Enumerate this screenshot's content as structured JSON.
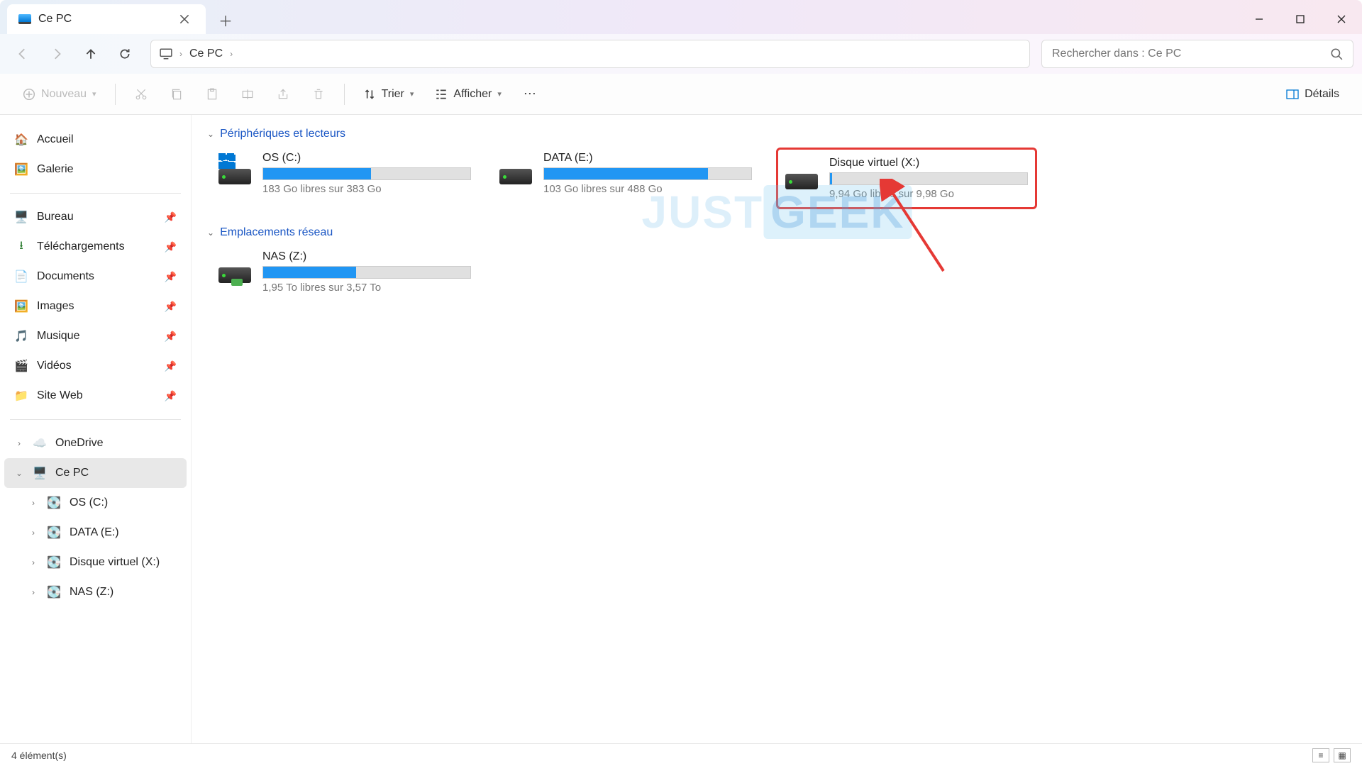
{
  "tab": {
    "title": "Ce PC"
  },
  "breadcrumb": {
    "root": "Ce PC"
  },
  "search": {
    "placeholder": "Rechercher dans : Ce PC"
  },
  "toolbar": {
    "new": "Nouveau",
    "sort": "Trier",
    "view": "Afficher",
    "details": "Détails"
  },
  "sidebar": {
    "home": "Accueil",
    "gallery": "Galerie",
    "pinned": [
      {
        "label": "Bureau"
      },
      {
        "label": "Téléchargements"
      },
      {
        "label": "Documents"
      },
      {
        "label": "Images"
      },
      {
        "label": "Musique"
      },
      {
        "label": "Vidéos"
      },
      {
        "label": "Site Web"
      }
    ],
    "onedrive": "OneDrive",
    "thispc": "Ce PC",
    "drives": [
      {
        "label": "OS (C:)"
      },
      {
        "label": "DATA (E:)"
      },
      {
        "label": "Disque virtuel (X:)"
      },
      {
        "label": "NAS (Z:)"
      }
    ]
  },
  "groups": {
    "devices": "Périphériques et lecteurs",
    "network": "Emplacements réseau"
  },
  "drives": [
    {
      "name": "OS (C:)",
      "space": "183 Go libres sur 383 Go",
      "fill": 52
    },
    {
      "name": "DATA (E:)",
      "space": "103 Go libres sur 488 Go",
      "fill": 79
    },
    {
      "name": "Disque virtuel (X:)",
      "space": "9,94 Go libres sur 9,98 Go",
      "fill": 1
    }
  ],
  "network_drives": [
    {
      "name": "NAS (Z:)",
      "space": "1,95 To libres sur 3,57 To",
      "fill": 45
    }
  ],
  "watermark": {
    "a": "JUST",
    "b": "GEEK"
  },
  "status": {
    "count": "4 élément(s)"
  }
}
